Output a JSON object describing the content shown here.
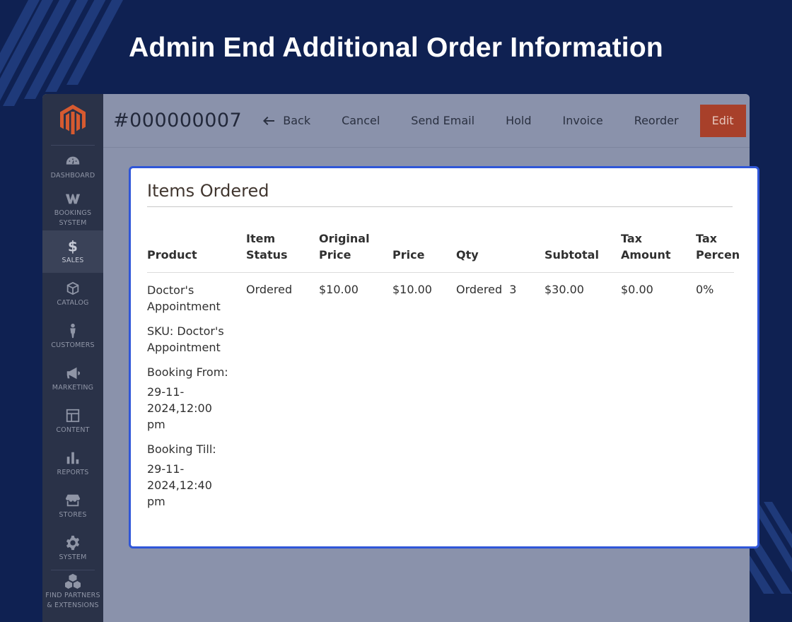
{
  "headline": "Admin End Additional Order Information",
  "colors": {
    "background": "#0f2152",
    "sidebar": "#2a3248",
    "edit_button": "#a8402a",
    "card_border": "#2f56d8"
  },
  "sidebar": {
    "logo_icon": "magento-logo-icon",
    "items": [
      {
        "label": "DASHBOARD",
        "icon": "gauge-icon"
      },
      {
        "label": "BOOKINGS SYSTEM",
        "icon": "bookings-w-icon"
      },
      {
        "label": "SALES",
        "icon": "dollar-icon",
        "active": true
      },
      {
        "label": "CATALOG",
        "icon": "box-icon"
      },
      {
        "label": "CUSTOMERS",
        "icon": "person-icon"
      },
      {
        "label": "MARKETING",
        "icon": "megaphone-icon"
      },
      {
        "label": "CONTENT",
        "icon": "layout-icon"
      },
      {
        "label": "REPORTS",
        "icon": "bar-chart-icon"
      },
      {
        "label": "STORES",
        "icon": "storefront-icon"
      },
      {
        "label": "SYSTEM",
        "icon": "gear-icon"
      },
      {
        "label": "FIND PARTNERS & EXTENSIONS",
        "icon": "cubes-icon"
      }
    ]
  },
  "toolbar": {
    "order_number": "#000000007",
    "back": "Back",
    "cancel": "Cancel",
    "send_email": "Send Email",
    "hold": "Hold",
    "invoice": "Invoice",
    "reorder": "Reorder",
    "edit": "Edit"
  },
  "items_ordered": {
    "title": "Items Ordered",
    "columns": [
      {
        "line1": "",
        "line2": "Product"
      },
      {
        "line1": "Item",
        "line2": "Status"
      },
      {
        "line1": "Original",
        "line2": "Price"
      },
      {
        "line1": "",
        "line2": "Price"
      },
      {
        "line1": "",
        "line2": "Qty"
      },
      {
        "line1": "",
        "line2": "Subtotal"
      },
      {
        "line1": "Tax",
        "line2": "Amount"
      },
      {
        "line1": "Tax",
        "line2": "Percen"
      }
    ],
    "row": {
      "product_name": "Doctor's Appointment",
      "sku": "SKU: Doctor's Appointment",
      "booking_from_label": "Booking From:",
      "booking_from": "29-11-2024,12:00 pm",
      "booking_till_label": "Booking Till:",
      "booking_till": "29-11-2024,12:40 pm",
      "item_status": "Ordered",
      "original_price": "$10.00",
      "price": "$10.00",
      "qty": "Ordered  3",
      "subtotal": "$30.00",
      "tax_amount": "$0.00",
      "tax_percent": "0%"
    }
  }
}
